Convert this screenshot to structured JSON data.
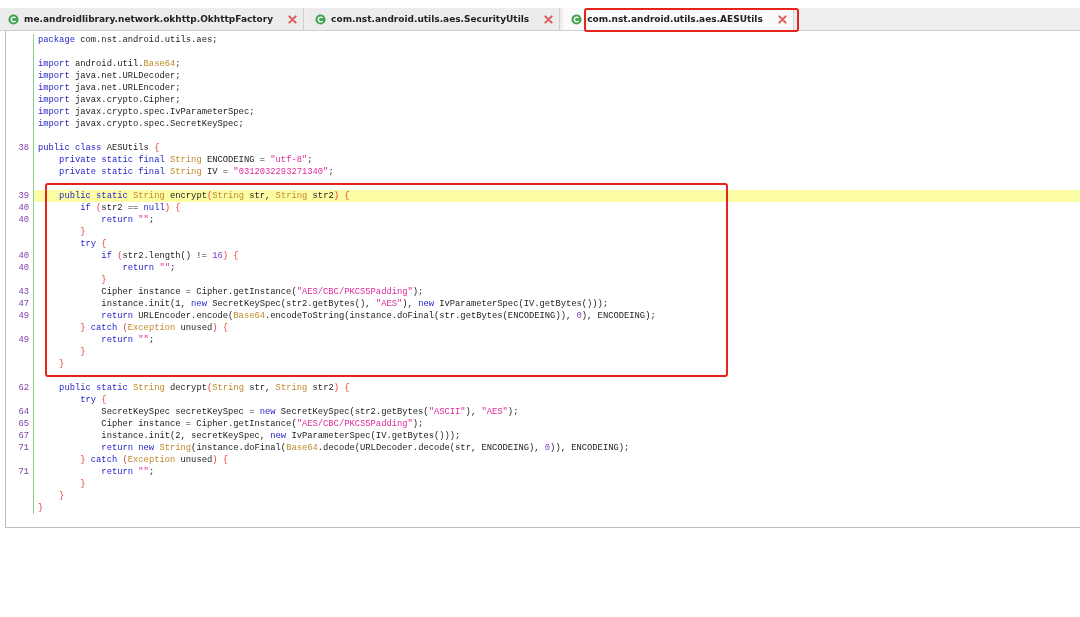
{
  "tabs": [
    {
      "label": "me.androidlibrary.network.okhttp.OkhttpFactory",
      "selected": false,
      "outlined": false
    },
    {
      "label": "com.nst.android.utils.aes.SecurityUtils",
      "selected": false,
      "outlined": false
    },
    {
      "label": "com.nst.android.utils.aes.AESUtils",
      "selected": true,
      "outlined": true
    }
  ],
  "code": {
    "blocks": [
      {
        "outlined": false,
        "lines": [
          {
            "tokens": [
              {
                "kind": "kw",
                "text": "package"
              },
              {
                "kind": "plain",
                "text": " com.nst.android.utils.aes;"
              }
            ]
          },
          {
            "space_above": true,
            "tokens": [
              {
                "kind": "kw",
                "text": "import"
              },
              {
                "kind": "plain",
                "text": " android.util."
              },
              {
                "kind": "type",
                "text": "Base64"
              },
              {
                "kind": "plain",
                "text": ";"
              }
            ]
          },
          {
            "tokens": [
              {
                "kind": "kw",
                "text": "import"
              },
              {
                "kind": "plain",
                "text": " java.net.URLDecoder;"
              }
            ]
          },
          {
            "tokens": [
              {
                "kind": "kw",
                "text": "import"
              },
              {
                "kind": "plain",
                "text": " java.net.URLEncoder;"
              }
            ]
          },
          {
            "tokens": [
              {
                "kind": "kw",
                "text": "import"
              },
              {
                "kind": "plain",
                "text": " javax.crypto.Cipher;"
              }
            ]
          },
          {
            "tokens": [
              {
                "kind": "kw",
                "text": "import"
              },
              {
                "kind": "plain",
                "text": " javax.crypto.spec.IvParameterSpec;"
              }
            ]
          },
          {
            "tokens": [
              {
                "kind": "kw",
                "text": "import"
              },
              {
                "kind": "plain",
                "text": " javax.crypto.spec.SecretKeySpec;"
              }
            ]
          },
          {
            "space_above": true,
            "number": "38",
            "tokens": [
              {
                "kind": "kw",
                "text": "public class"
              },
              {
                "kind": "plain",
                "text": " AESUtils "
              },
              {
                "kind": "punc",
                "text": "{"
              }
            ]
          },
          {
            "tokens": [
              {
                "kind": "kw",
                "text": "    private static final "
              },
              {
                "kind": "type",
                "text": "String"
              },
              {
                "kind": "plain",
                "text": " ENCODEING = "
              },
              {
                "kind": "str",
                "text": "\"utf-8\""
              },
              {
                "kind": "plain",
                "text": ";"
              }
            ]
          },
          {
            "tokens": [
              {
                "kind": "kw",
                "text": "    private static final "
              },
              {
                "kind": "type",
                "text": "String"
              },
              {
                "kind": "plain",
                "text": " IV = "
              },
              {
                "kind": "str",
                "text": "\"0312032293271340\""
              },
              {
                "kind": "plain",
                "text": ";"
              }
            ]
          }
        ]
      },
      {
        "outlined": true,
        "lines": [
          {
            "space_above": true,
            "number": "39",
            "highlighted": true,
            "tokens": [
              {
                "kind": "kw",
                "text": "    public static "
              },
              {
                "kind": "type",
                "text": "String"
              },
              {
                "kind": "plain",
                "text": " encrypt"
              },
              {
                "kind": "punc",
                "text": "("
              },
              {
                "kind": "type",
                "text": "String"
              },
              {
                "kind": "plain",
                "text": " str, "
              },
              {
                "kind": "type",
                "text": "String"
              },
              {
                "kind": "plain",
                "text": " str2"
              },
              {
                "kind": "punc",
                "text": ") {"
              }
            ]
          },
          {
            "number": "40",
            "tokens": [
              {
                "kind": "kw",
                "text": "        if "
              },
              {
                "kind": "punc",
                "text": "("
              },
              {
                "kind": "plain",
                "text": "str2 == "
              },
              {
                "kind": "kw",
                "text": "null"
              },
              {
                "kind": "punc",
                "text": ") {"
              }
            ]
          },
          {
            "number": "40",
            "tokens": [
              {
                "kind": "kw",
                "text": "            return "
              },
              {
                "kind": "str",
                "text": "\"\""
              },
              {
                "kind": "plain",
                "text": ";"
              }
            ]
          },
          {
            "tokens": [
              {
                "kind": "punc",
                "text": "        }"
              }
            ]
          },
          {
            "tokens": [
              {
                "kind": "kw",
                "text": "        try "
              },
              {
                "kind": "punc",
                "text": "{"
              }
            ]
          },
          {
            "number": "40",
            "tokens": [
              {
                "kind": "kw",
                "text": "            if "
              },
              {
                "kind": "punc",
                "text": "("
              },
              {
                "kind": "plain",
                "text": "str2.length() != "
              },
              {
                "kind": "num",
                "text": "16"
              },
              {
                "kind": "punc",
                "text": ") {"
              }
            ]
          },
          {
            "number": "40",
            "tokens": [
              {
                "kind": "kw",
                "text": "                return "
              },
              {
                "kind": "str",
                "text": "\"\""
              },
              {
                "kind": "plain",
                "text": ";"
              }
            ]
          },
          {
            "tokens": [
              {
                "kind": "punc",
                "text": "            }"
              }
            ]
          },
          {
            "number": "43",
            "tokens": [
              {
                "kind": "plain",
                "text": "            Cipher instance = Cipher.getInstance("
              },
              {
                "kind": "str",
                "text": "\"AES/CBC/PKCS5Padding\""
              },
              {
                "kind": "plain",
                "text": ");"
              }
            ]
          },
          {
            "number": "47",
            "tokens": [
              {
                "kind": "plain",
                "text": "            instance.init(1, "
              },
              {
                "kind": "kw",
                "text": "new"
              },
              {
                "kind": "plain",
                "text": " SecretKeySpec(str2.getBytes(), "
              },
              {
                "kind": "str",
                "text": "\"AES\""
              },
              {
                "kind": "plain",
                "text": "), "
              },
              {
                "kind": "kw",
                "text": "new"
              },
              {
                "kind": "plain",
                "text": " IvParameterSpec(IV.getBytes()));"
              }
            ]
          },
          {
            "number": "49",
            "tokens": [
              {
                "kind": "kw",
                "text": "            return"
              },
              {
                "kind": "plain",
                "text": " URLEncoder.encode("
              },
              {
                "kind": "type",
                "text": "Base64"
              },
              {
                "kind": "plain",
                "text": ".encodeToString(instance.doFinal(str.getBytes(ENCODEING)), "
              },
              {
                "kind": "num",
                "text": "0"
              },
              {
                "kind": "plain",
                "text": "), ENCODEING);"
              }
            ]
          },
          {
            "tokens": [
              {
                "kind": "punc",
                "text": "        } "
              },
              {
                "kind": "kw",
                "text": "catch "
              },
              {
                "kind": "punc",
                "text": "("
              },
              {
                "kind": "type",
                "text": "Exception"
              },
              {
                "kind": "plain",
                "text": " unused"
              },
              {
                "kind": "punc",
                "text": ") {"
              }
            ]
          },
          {
            "number": "49",
            "tokens": [
              {
                "kind": "kw",
                "text": "            return "
              },
              {
                "kind": "str",
                "text": "\"\""
              },
              {
                "kind": "plain",
                "text": ";"
              }
            ]
          },
          {
            "tokens": [
              {
                "kind": "punc",
                "text": "        }"
              }
            ]
          },
          {
            "tokens": [
              {
                "kind": "punc",
                "text": "    }"
              }
            ]
          }
        ]
      },
      {
        "outlined": false,
        "lines": [
          {
            "space_above": true,
            "number": "62",
            "tokens": [
              {
                "kind": "kw",
                "text": "    public static "
              },
              {
                "kind": "type",
                "text": "String"
              },
              {
                "kind": "plain",
                "text": " decrypt"
              },
              {
                "kind": "punc",
                "text": "("
              },
              {
                "kind": "type",
                "text": "String"
              },
              {
                "kind": "plain",
                "text": " str, "
              },
              {
                "kind": "type",
                "text": "String"
              },
              {
                "kind": "plain",
                "text": " str2"
              },
              {
                "kind": "punc",
                "text": ") {"
              }
            ]
          },
          {
            "tokens": [
              {
                "kind": "kw",
                "text": "        try "
              },
              {
                "kind": "punc",
                "text": "{"
              }
            ]
          },
          {
            "number": "64",
            "tokens": [
              {
                "kind": "plain",
                "text": "            SecretKeySpec secretKeySpec = "
              },
              {
                "kind": "kw",
                "text": "new"
              },
              {
                "kind": "plain",
                "text": " SecretKeySpec(str2.getBytes("
              },
              {
                "kind": "str",
                "text": "\"ASCII\""
              },
              {
                "kind": "plain",
                "text": "), "
              },
              {
                "kind": "str",
                "text": "\"AES\""
              },
              {
                "kind": "plain",
                "text": ");"
              }
            ]
          },
          {
            "number": "65",
            "tokens": [
              {
                "kind": "plain",
                "text": "            Cipher instance = Cipher.getInstance("
              },
              {
                "kind": "str",
                "text": "\"AES/CBC/PKCS5Padding\""
              },
              {
                "kind": "plain",
                "text": ");"
              }
            ]
          },
          {
            "number": "67",
            "tokens": [
              {
                "kind": "plain",
                "text": "            instance.init(2, secretKeySpec, "
              },
              {
                "kind": "kw",
                "text": "new"
              },
              {
                "kind": "plain",
                "text": " IvParameterSpec(IV.getBytes()));"
              }
            ]
          },
          {
            "number": "71",
            "tokens": [
              {
                "kind": "kw",
                "text": "            return new "
              },
              {
                "kind": "type",
                "text": "String"
              },
              {
                "kind": "plain",
                "text": "(instance.doFinal("
              },
              {
                "kind": "type",
                "text": "Base64"
              },
              {
                "kind": "plain",
                "text": ".decode(URLDecoder.decode(str, ENCODEING), "
              },
              {
                "kind": "num",
                "text": "0"
              },
              {
                "kind": "plain",
                "text": ")), ENCODEING);"
              }
            ]
          },
          {
            "tokens": [
              {
                "kind": "punc",
                "text": "        } "
              },
              {
                "kind": "kw",
                "text": "catch "
              },
              {
                "kind": "punc",
                "text": "("
              },
              {
                "kind": "type",
                "text": "Exception"
              },
              {
                "kind": "plain",
                "text": " unused"
              },
              {
                "kind": "punc",
                "text": ") {"
              }
            ]
          },
          {
            "number": "71",
            "tokens": [
              {
                "kind": "kw",
                "text": "            return "
              },
              {
                "kind": "str",
                "text": "\"\""
              },
              {
                "kind": "plain",
                "text": ";"
              }
            ]
          },
          {
            "tokens": [
              {
                "kind": "punc",
                "text": "        }"
              }
            ]
          },
          {
            "tokens": [
              {
                "kind": "punc",
                "text": "    }"
              }
            ]
          },
          {
            "tokens": [
              {
                "kind": "punc",
                "text": "}"
              }
            ]
          }
        ]
      }
    ]
  }
}
